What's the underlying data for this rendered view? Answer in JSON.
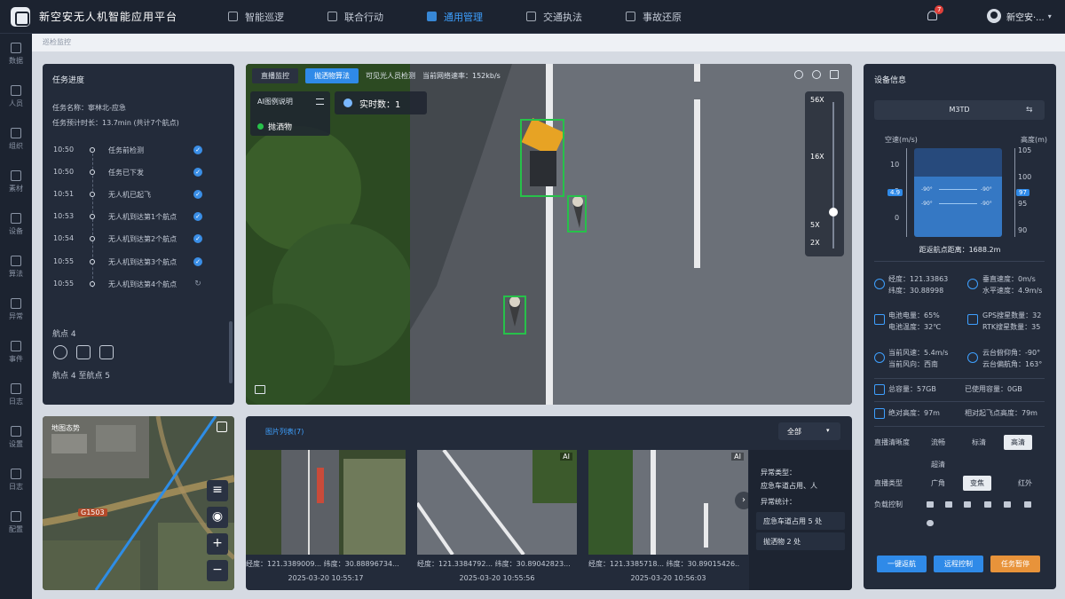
{
  "app": {
    "title": "新空安无人机智能应用平台"
  },
  "nav": {
    "tabs": [
      {
        "label": "智能巡逻",
        "icon": "shield-icon"
      },
      {
        "label": "联合行动",
        "icon": "briefcase-icon"
      },
      {
        "label": "通用管理",
        "icon": "grid-icon"
      },
      {
        "label": "交通执法",
        "icon": "clipboard-icon"
      },
      {
        "label": "事故还原",
        "icon": "car-icon"
      }
    ]
  },
  "header": {
    "notification_count": "7",
    "user_name": "新空安·...",
    "caret": "▾"
  },
  "rail": {
    "items": [
      {
        "label": "数据",
        "icon": "monitor-icon"
      },
      {
        "label": "人员",
        "icon": "person-icon"
      },
      {
        "label": "组织",
        "icon": "org-icon"
      },
      {
        "label": "素材",
        "icon": "image-icon"
      },
      {
        "label": "设备",
        "icon": "device-icon"
      },
      {
        "label": "算法",
        "icon": "algorithm-icon"
      },
      {
        "label": "异常",
        "icon": "alert-icon"
      },
      {
        "label": "事件",
        "icon": "calendar-icon"
      },
      {
        "label": "日志",
        "icon": "doc-icon"
      },
      {
        "label": "设置",
        "icon": "gear-icon"
      },
      {
        "label": "日志",
        "icon": "list-icon"
      },
      {
        "label": "配置",
        "icon": "config-icon"
      }
    ]
  },
  "breadcrumb": "巡检监控",
  "task": {
    "title": "任务进度",
    "name": "任务名称：寧林北-应急",
    "duration": "任务预计时长：13.7min (共计7个航点)",
    "timeline": [
      {
        "time": "10:50",
        "label": "任务前检测",
        "done": true
      },
      {
        "time": "10:50",
        "label": "任务已下发",
        "done": true
      },
      {
        "time": "10:51",
        "label": "无人机已起飞",
        "done": true
      },
      {
        "time": "10:53",
        "label": "无人机到达第1个航点",
        "done": true
      },
      {
        "time": "10:54",
        "label": "无人机到达第2个航点",
        "done": true
      },
      {
        "time": "10:55",
        "label": "无人机到达第3个航点",
        "done": true
      },
      {
        "time": "10:55",
        "label": "无人机到达第4个航点",
        "done": false
      }
    ],
    "check_mark": "✓",
    "pending_mark": "↻",
    "waypoint_title": "航点 4",
    "waypoint_sub": "航点 4 至航点 5"
  },
  "map": {
    "title": "地图态势",
    "road_tag": "G1503",
    "zoom_in": "+",
    "zoom_out": "−",
    "layers": "≡",
    "eye": "◉"
  },
  "video": {
    "tabs": [
      "直播监控",
      "抛洒物算法"
    ],
    "active_tab": 1,
    "infrared": "可见光人员检测",
    "rate": "当前网络速率：152kb/s",
    "ai_title": "AI图例说明",
    "ai_item": "抛洒物",
    "count_label": "实时数：1",
    "zoom": [
      "56X",
      "16X",
      "5X",
      "2X"
    ]
  },
  "images": {
    "title": "图片列表(7)",
    "filter": "全部",
    "ai_tag": "AI",
    "items": [
      {
        "coords": "经度：121.3389009...  纬度：30.88896734...",
        "time": "2025-03-20 10:55:17"
      },
      {
        "coords": "经度：121.3384792...  纬度：30.89042823...",
        "time": "2025-03-20 10:55:56"
      },
      {
        "coords": "经度：121.3385718...  纬度：30.89015426...",
        "time": "2025-03-20 10:56:03"
      }
    ],
    "abnormal_type_label": "异常类型：",
    "abnormal_type_value": "应急车道占用、人",
    "abnormal_stats_label": "异常统计：",
    "stats": [
      "应急车道占用 5 处",
      "抛洒物 2 处"
    ],
    "next": "›"
  },
  "device": {
    "title": "设备信息",
    "model": "M3TD",
    "switch_icon": "⇆",
    "airspeed_label": "空速(m/s)",
    "altitude_label": "高度(m)",
    "speed_ticks": [
      "10",
      "5",
      "0"
    ],
    "speed_value": "4.9",
    "alt_ticks": [
      "105",
      "100",
      "95",
      "90"
    ],
    "alt_value": "97",
    "pitch_labels": [
      "-90°",
      "-90°",
      "-90°",
      "-90°"
    ],
    "distance": "距返航点距离：1688.2m",
    "lon": "经度：121.33863",
    "lat": "纬度：30.88998",
    "vspeed": "垂直速度：0m/s",
    "hspeed": "水平速度：4.9m/s",
    "battery": "电池电量：65%",
    "battery_temp": "电池温度：32℃",
    "gps": "GPS搜星数量：32",
    "rtk": "RTK搜星数量：35",
    "wind_speed": "当前风速：5.4m/s",
    "wind_dir": "当前风向：西南",
    "gimbal_pitch": "云台俯仰角：-90°",
    "gimbal_yaw": "云台偏航角：163°",
    "total_cap": "总容量：57GB",
    "used_cap": "已使用容量：0GB",
    "abs_height": "绝对高度：97m",
    "rel_height": "相对起飞点高度：79m",
    "quality_label": "直播清晰度",
    "quality_opts": [
      "流畅",
      "标清",
      "高清",
      "超清"
    ],
    "quality_selected": 2,
    "type_label": "直播类型",
    "type_opts": [
      "广角",
      "变焦",
      "红外"
    ],
    "type_selected": 1,
    "payload_label": "负载控制",
    "buttons": [
      "一键返航",
      "远程控制",
      "任务暂停"
    ]
  }
}
